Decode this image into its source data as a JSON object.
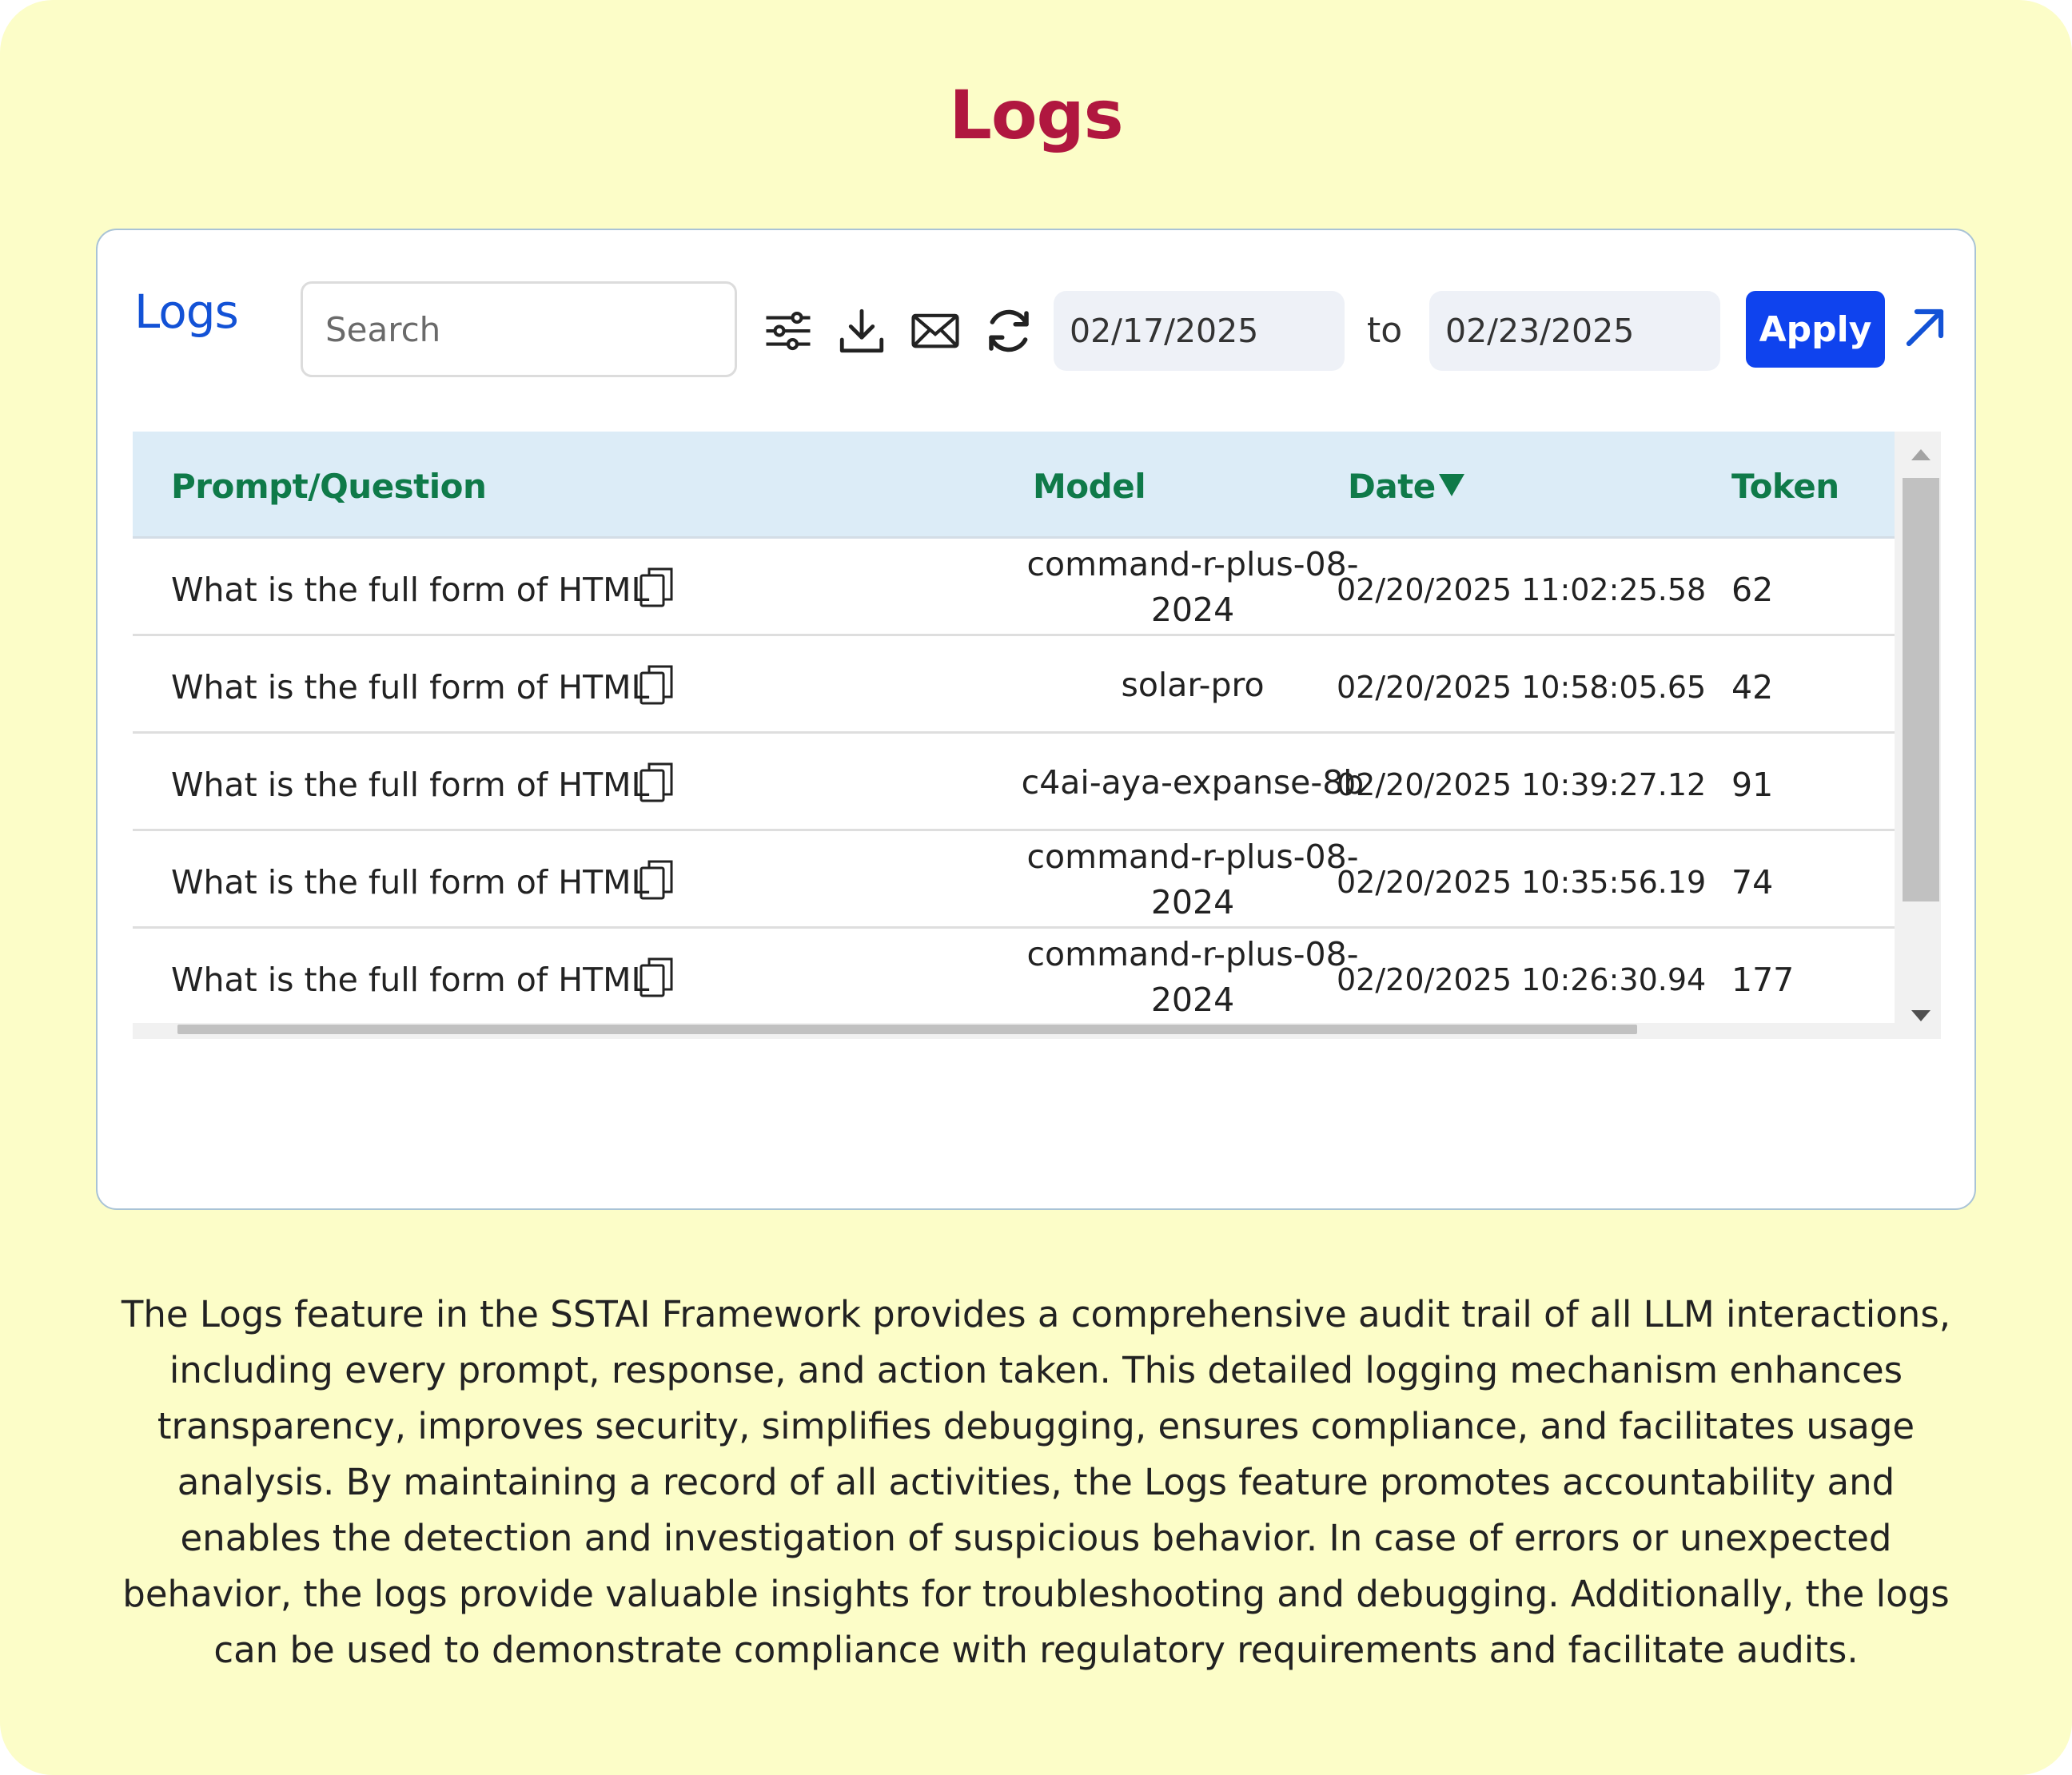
{
  "page": {
    "title": "Logs",
    "description": "The Logs feature in the SSTAI Framework provides a comprehensive audit trail of all LLM interactions, including every prompt, response, and action taken. This detailed logging mechanism enhances transparency, improves security, simplifies debugging, ensures compliance, and facilitates usage analysis. By maintaining a record of all activities, the Logs feature promotes accountability and enables the detection and investigation of suspicious behavior. In case of errors or unexpected behavior, the logs provide valuable insights for troubleshooting and debugging. Additionally, the logs can be used to demonstrate compliance with regulatory requirements and facilitate audits."
  },
  "colors": {
    "background": "#fcfdc8",
    "title": "#b0173f",
    "panel_title": "#1352d6",
    "header_bg": "#dcecf7",
    "header_text": "#0f7a49",
    "apply_bg": "#0f43ee"
  },
  "panel": {
    "title": "Logs",
    "search": {
      "placeholder": "Search",
      "value": ""
    },
    "toolbar_icons": [
      "filter-sliders-icon",
      "download-icon",
      "mail-icon",
      "refresh-icon"
    ],
    "date_from": "02/17/2025",
    "to_label": "to",
    "date_to": "02/23/2025",
    "apply_label": "Apply",
    "expand_icon": "arrow-up-right-icon"
  },
  "table": {
    "columns": [
      "Prompt/Question",
      "Model",
      "Date",
      "Token"
    ],
    "sort": {
      "column": "Date",
      "direction": "descending"
    },
    "rows": [
      {
        "prompt": "What is the full form of HTML",
        "model": "command-r-plus-08-2024",
        "date": "02/20/2025 11:02:25.58",
        "token": "62"
      },
      {
        "prompt": "What is the full form of HTML",
        "model": "solar-pro",
        "date": "02/20/2025 10:58:05.65",
        "token": "42"
      },
      {
        "prompt": "What is the full form of HTML",
        "model": "c4ai-aya-expanse-8b",
        "date": "02/20/2025 10:39:27.12",
        "token": "91"
      },
      {
        "prompt": "What is the full form of HTML",
        "model": "command-r-plus-08-2024",
        "date": "02/20/2025 10:35:56.19",
        "token": "74"
      },
      {
        "prompt": "What is the full form of HTML",
        "model": "command-r-plus-08-2024",
        "date": "02/20/2025 10:26:30.94",
        "token": "177"
      }
    ]
  }
}
